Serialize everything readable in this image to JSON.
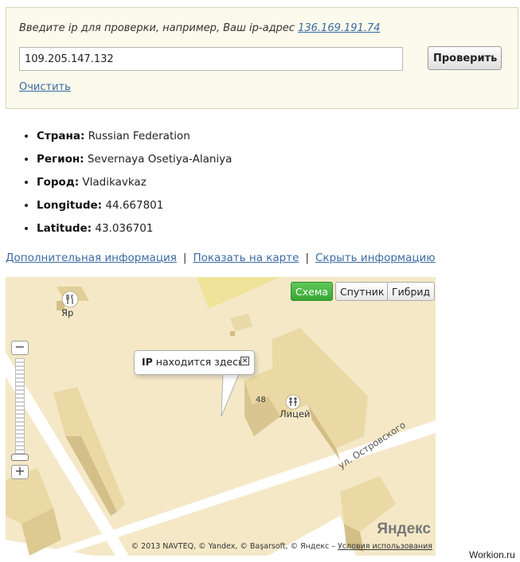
{
  "form": {
    "hint_text": "Введите ip для проверки, например, Ваш ip-адрес",
    "own_ip_link": "136.169.191.74",
    "input_value": "109.205.147.132",
    "check_button": "Проверить",
    "clear_link": "Очистить"
  },
  "info": {
    "items": [
      {
        "label": "Страна:",
        "value": "Russian Federation"
      },
      {
        "label": "Регион:",
        "value": "Severnaya Osetiya-Alaniya"
      },
      {
        "label": "Город:",
        "value": "Vladikavkaz"
      },
      {
        "label": "Longitude:",
        "value": "44.667801"
      },
      {
        "label": "Latitude:",
        "value": "43.036701"
      }
    ]
  },
  "links": {
    "more_info": "Дополнительная информация",
    "sep1": "|",
    "show_on_map": "Показать на карте",
    "sep2": "|",
    "hide_info": "Скрыть информацию"
  },
  "map": {
    "buttons": {
      "scheme": "Схема",
      "satellite": "Спутник",
      "hybrid": "Гибрид"
    },
    "zoom_plus": "+",
    "zoom_minus": "−",
    "balloon_bold": "IP",
    "balloon_text": "находится здесь",
    "balloon_close": "✕",
    "poi_restaurant": "Яр",
    "poi_school": "Лицей",
    "house_number": "48",
    "street_name": "ул. Островского",
    "logo": "Яндекс",
    "copyright_text": "© 2013 NAVTEQ, © Yandex, © Başarsoft, © Яндекс –",
    "terms_link": "Условия использования",
    "colors": {
      "map_bg": "#f4e8c7",
      "building": "#e9d9a8",
      "road": "#ffffff",
      "active_button": "#36a532"
    }
  },
  "footer": {
    "site": "Workion.ru"
  }
}
